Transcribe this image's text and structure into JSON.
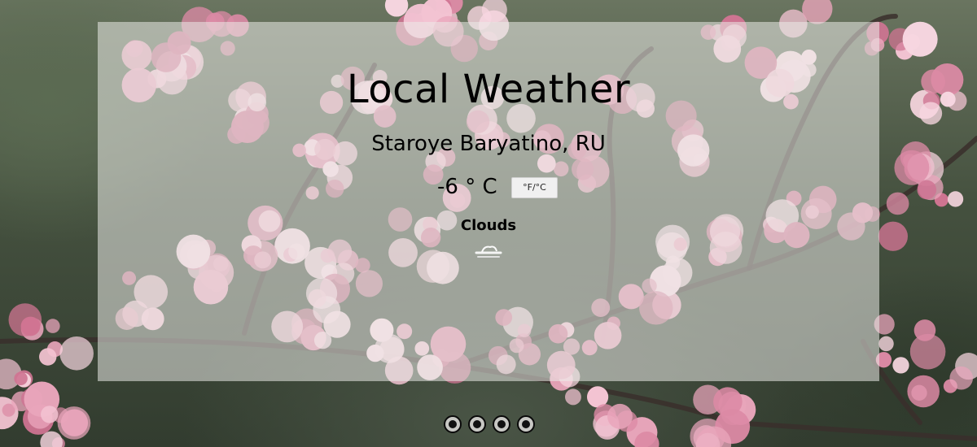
{
  "app": {
    "title": "Local Weather"
  },
  "weather": {
    "location": "Staroye Baryatino, RU",
    "temperature": "-6 ° C",
    "unit_toggle_label": "°F/°C",
    "condition": "Clouds",
    "condition_icon": "clouds-icon"
  },
  "footer": {
    "icons": [
      "social-link-icon-1",
      "social-link-icon-2",
      "social-link-icon-3",
      "social-link-icon-4"
    ]
  },
  "colors": {
    "card_overlay": "#ebebe8",
    "blossom": "#e7a9bd",
    "text": "#000000"
  }
}
